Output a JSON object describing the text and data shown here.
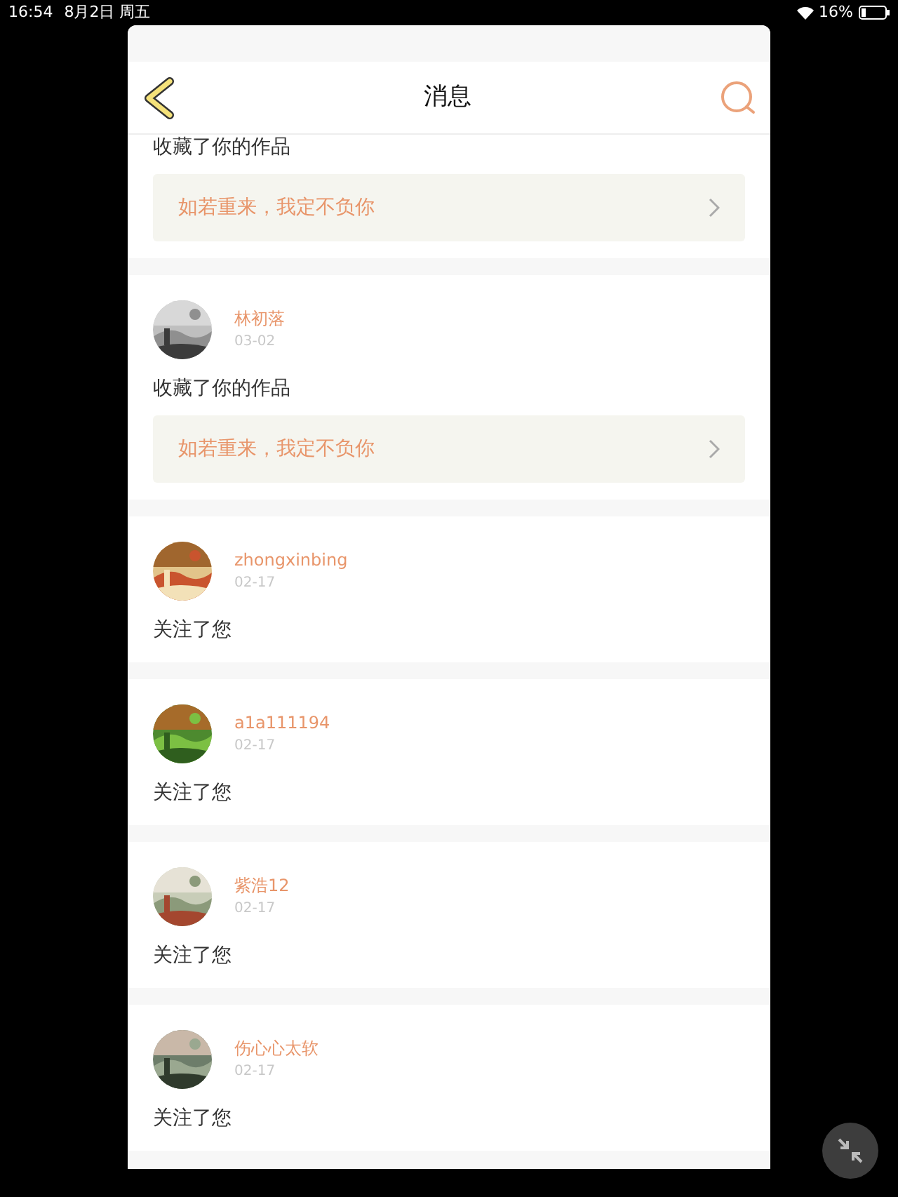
{
  "status_bar": {
    "time": "16:54",
    "date": "8月2日 周五",
    "battery": "16%"
  },
  "header": {
    "title": "消息"
  },
  "messages": [
    {
      "kind": "favorite",
      "action": "收藏了你的作品",
      "quote": "如若重来，我定不负你"
    },
    {
      "kind": "favorite",
      "user": "林初落",
      "date": "03-02",
      "action": "收藏了你的作品",
      "quote": "如若重来，我定不负你"
    },
    {
      "kind": "follow",
      "user": "zhongxinbing",
      "date": "02-17",
      "action": "关注了您"
    },
    {
      "kind": "follow",
      "user": "a1a111194",
      "date": "02-17",
      "action": "关注了您"
    },
    {
      "kind": "follow",
      "user": "紫浩12",
      "date": "02-17",
      "action": "关注了您"
    },
    {
      "kind": "follow",
      "user": "伤心心太软",
      "date": "02-17",
      "action": "关注了您"
    }
  ]
}
